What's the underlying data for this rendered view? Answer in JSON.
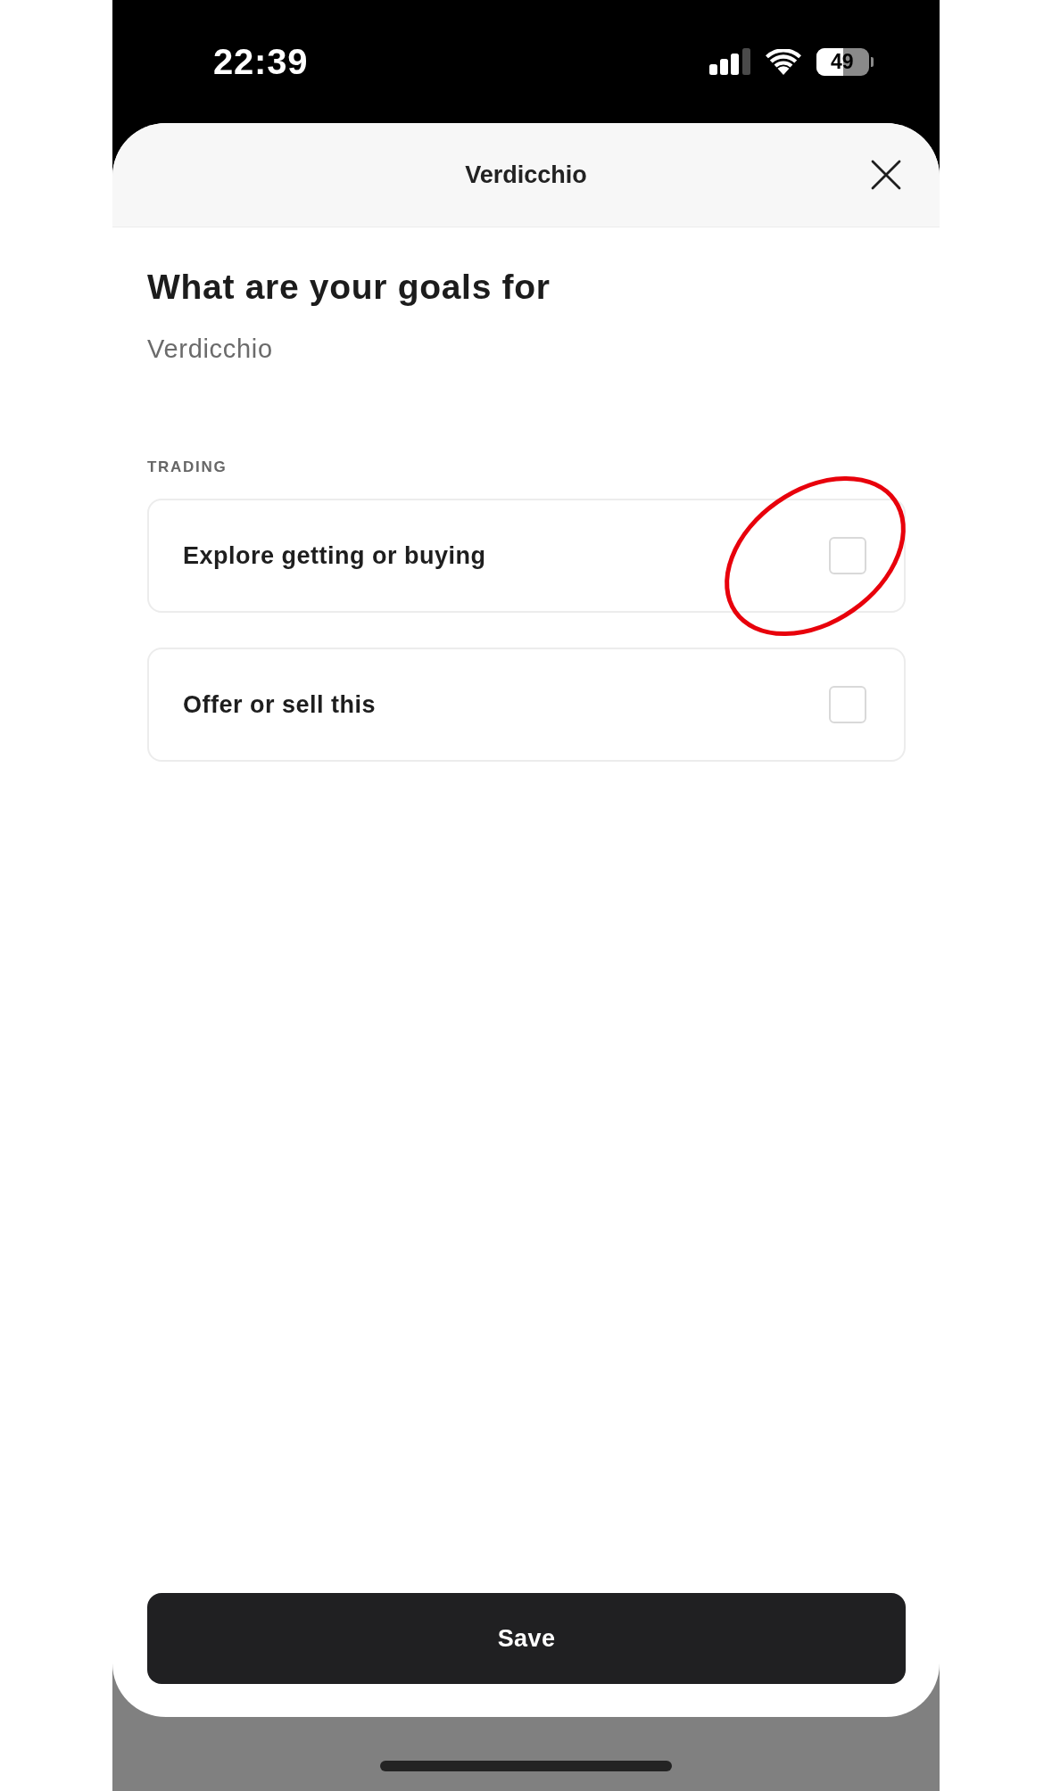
{
  "status_bar": {
    "time": "22:39",
    "battery": "49"
  },
  "sheet": {
    "title": "Verdicchio"
  },
  "heading": "What are your goals for",
  "subtitle": "Verdicchio",
  "section": {
    "label": "TRADING",
    "options": [
      {
        "label": "Explore getting or buying",
        "checked": false,
        "highlighted": true
      },
      {
        "label": "Offer or sell this",
        "checked": false,
        "highlighted": false
      }
    ]
  },
  "save_button": {
    "label": "Save"
  }
}
